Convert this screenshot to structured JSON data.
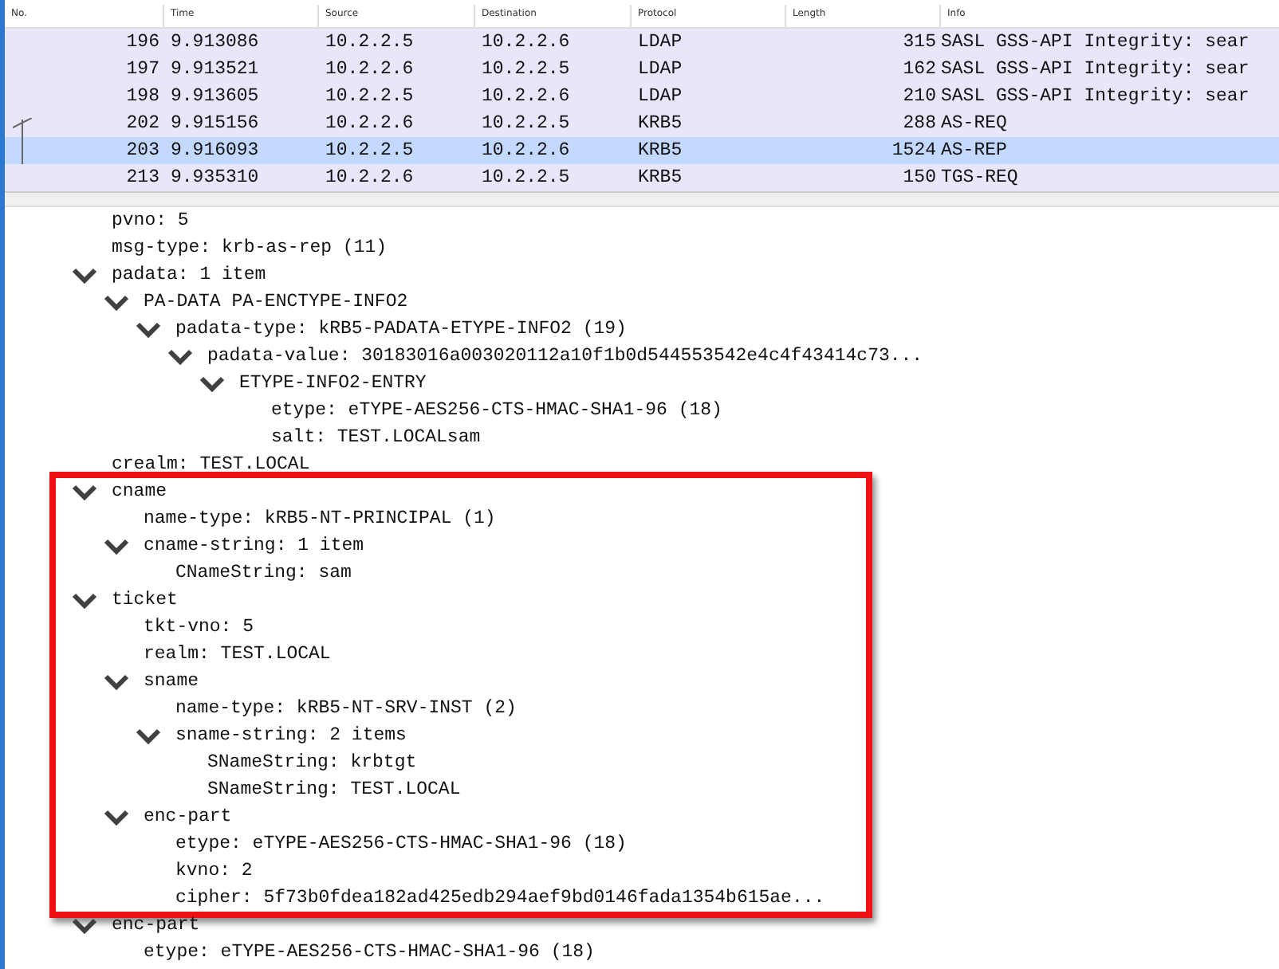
{
  "packet_list": {
    "columns": [
      "No.",
      "Time",
      "Source",
      "Destination",
      "Protocol",
      "Length",
      "Info"
    ],
    "rows": [
      {
        "cells": [
          "196",
          "9.913086",
          "10.2.2.5",
          "10.2.2.6",
          "LDAP",
          "315",
          "SASL GSS-API Integrity: sear"
        ],
        "selected": false
      },
      {
        "cells": [
          "197",
          "9.913521",
          "10.2.2.6",
          "10.2.2.5",
          "LDAP",
          "162",
          "SASL GSS-API Integrity: sear"
        ],
        "selected": false
      },
      {
        "cells": [
          "198",
          "9.913605",
          "10.2.2.5",
          "10.2.2.6",
          "LDAP",
          "210",
          "SASL GSS-API Integrity: sear"
        ],
        "selected": false
      },
      {
        "cells": [
          "202",
          "9.915156",
          "10.2.2.6",
          "10.2.2.5",
          "KRB5",
          "288",
          "AS-REQ"
        ],
        "selected": false,
        "kind": "request"
      },
      {
        "cells": [
          "203",
          "9.916093",
          "10.2.2.5",
          "10.2.2.6",
          "KRB5",
          "1524",
          "AS-REP"
        ],
        "selected": true,
        "kind": "response"
      },
      {
        "cells": [
          "213",
          "9.935310",
          "10.2.2.6",
          "10.2.2.5",
          "KRB5",
          "150",
          "TGS-REQ"
        ],
        "selected": false
      }
    ]
  },
  "details": [
    {
      "label": "pvno: 5"
    },
    {
      "label": "msg-type: krb-as-rep (11)"
    },
    {
      "label": "padata: 1 item",
      "expanded": true,
      "children": [
        {
          "label": "PA-DATA PA-ENCTYPE-INFO2",
          "expanded": true,
          "children": [
            {
              "label": "padata-type: kRB5-PADATA-ETYPE-INFO2 (19)",
              "expanded": true,
              "children": [
                {
                  "label": "padata-value: 30183016a003020112a10f1b0d544553542e4c4f43414c73...",
                  "expanded": true,
                  "children": [
                    {
                      "label": "ETYPE-INFO2-ENTRY",
                      "expanded": true,
                      "children": [
                        {
                          "label": "etype: eTYPE-AES256-CTS-HMAC-SHA1-96 (18)"
                        },
                        {
                          "label": "salt: TEST.LOCALsam"
                        }
                      ]
                    }
                  ]
                }
              ]
            }
          ]
        }
      ]
    },
    {
      "label": "crealm: TEST.LOCAL"
    },
    {
      "label": "cname",
      "expanded": true,
      "highlighted": true,
      "children": [
        {
          "label": "name-type: kRB5-NT-PRINCIPAL (1)"
        },
        {
          "label": "cname-string: 1 item",
          "expanded": true,
          "children": [
            {
              "label": "CNameString: sam"
            }
          ]
        }
      ]
    },
    {
      "label": "ticket",
      "expanded": true,
      "highlighted": true,
      "children": [
        {
          "label": "tkt-vno: 5"
        },
        {
          "label": "realm: TEST.LOCAL"
        },
        {
          "label": "sname",
          "expanded": true,
          "children": [
            {
              "label": "name-type: kRB5-NT-SRV-INST (2)"
            },
            {
              "label": "sname-string: 2 items",
              "expanded": true,
              "children": [
                {
                  "label": "SNameString: krbtgt"
                },
                {
                  "label": "SNameString: TEST.LOCAL"
                }
              ]
            }
          ]
        },
        {
          "label": "enc-part",
          "expanded": true,
          "children": [
            {
              "label": "etype: eTYPE-AES256-CTS-HMAC-SHA1-96 (18)"
            },
            {
              "label": "kvno: 2"
            },
            {
              "label": "cipher: 5f73b0fdea182ad425edb294aef9bd0146fada1354b615ae..."
            }
          ]
        }
      ]
    },
    {
      "label": "enc-part",
      "expanded": true,
      "children": [
        {
          "label": "etype: eTYPE-AES256-CTS-HMAC-SHA1-96 (18)"
        }
      ]
    }
  ]
}
